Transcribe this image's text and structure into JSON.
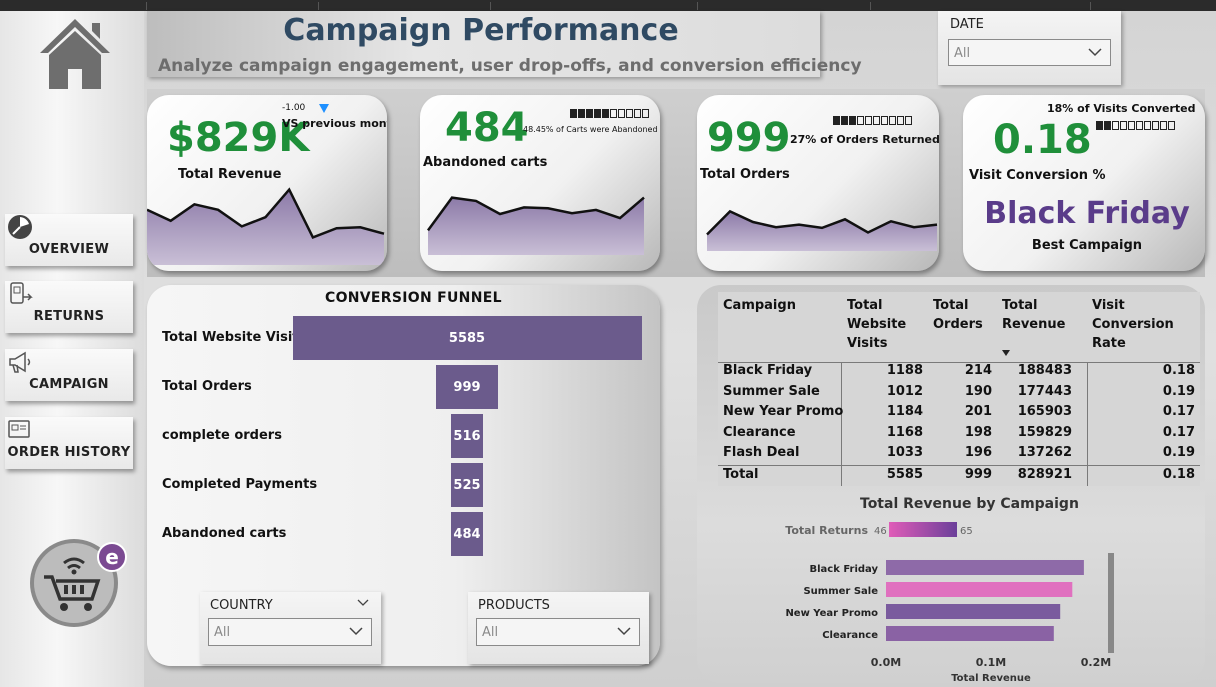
{
  "sidebar": {
    "nav": [
      {
        "label": "OVERVIEW",
        "icon": "overview-icon"
      },
      {
        "label": "RETURNS",
        "icon": "returns-icon"
      },
      {
        "label": "CAMPAIGN",
        "icon": "megaphone-icon"
      },
      {
        "label": "ORDER HISTORY",
        "icon": "order-history-icon"
      }
    ],
    "logo_icon": "ecommerce-cart-logo",
    "home_icon": "home-icon"
  },
  "header": {
    "title": "Campaign Performance",
    "subtitle": "Analyze campaign engagement, user drop-offs, and conversion efficiency"
  },
  "date_filter": {
    "label": "DATE",
    "value": "All"
  },
  "kpis": {
    "revenue": {
      "value": "$829K",
      "label": "Total Revenue",
      "delta": "-1.00",
      "delta_label": "VS previous month",
      "delta_color": "#1e90ff"
    },
    "abandoned": {
      "value": "484",
      "label": "Abandoned carts",
      "note": "48.45% of Carts were Abandoned",
      "filled_blocks": 5,
      "total_blocks": 10
    },
    "orders": {
      "value": "999",
      "label": "Total Orders",
      "note": "27% of Orders Returned",
      "filled_blocks": 3,
      "total_blocks": 10
    },
    "conversion": {
      "value": "0.18",
      "label": "Visit Conversion %",
      "note": "18% of Visits Converted",
      "filled_blocks": 2,
      "total_blocks": 10,
      "best_campaign": "Black Friday",
      "best_label": "Best Campaign"
    }
  },
  "colors": {
    "kpi_green": "#1f8f3a",
    "purple": "#6b5b8c",
    "best_purple": "#5a3c8a",
    "title_blue": "#2f4a63",
    "pink": "#e05cb8"
  },
  "funnel": {
    "title": "CONVERSION FUNNEL",
    "stages": [
      {
        "label": "Total Website Visits",
        "value": 5585
      },
      {
        "label": "Total Orders",
        "value": 999
      },
      {
        "label": "complete orders",
        "value": 516
      },
      {
        "label": "Completed Payments",
        "value": 525
      },
      {
        "label": "Abandoned carts",
        "value": 484
      }
    ]
  },
  "slicers": {
    "country": {
      "label": "COUNTRY",
      "value": "All"
    },
    "products": {
      "label": "PRODUCTS",
      "value": "All"
    }
  },
  "campaign_table": {
    "columns": [
      "Campaign",
      "Total Website Visits",
      "Total Orders",
      "Total Revenue",
      "Visit Conversion Rate"
    ],
    "rows": [
      [
        "Black Friday",
        "1188",
        "214",
        "188483",
        "0.18"
      ],
      [
        "Summer Sale",
        "1012",
        "190",
        "177443",
        "0.19"
      ],
      [
        "New Year Promo",
        "1184",
        "201",
        "165903",
        "0.17"
      ],
      [
        "Clearance",
        "1168",
        "198",
        "159829",
        "0.17"
      ],
      [
        "Flash Deal",
        "1033",
        "196",
        "137262",
        "0.19"
      ]
    ],
    "total": [
      "Total",
      "5585",
      "999",
      "828921",
      "0.18"
    ]
  },
  "chart_data": [
    {
      "type": "bar",
      "title": "Total Revenue by Campaign",
      "orientation": "horizontal",
      "categories": [
        "Black Friday",
        "Summer Sale",
        "New Year Promo",
        "Clearance"
      ],
      "values": [
        188483,
        177443,
        165903,
        159829
      ],
      "xlabel": "Total Revenue",
      "x_ticks": [
        "0.0M",
        "0.1M",
        "0.2M"
      ],
      "xlim": [
        0,
        200000
      ],
      "legend": {
        "label": "Total Returns",
        "min": "46",
        "max": "65"
      },
      "grid": false
    },
    {
      "type": "area",
      "title": "",
      "values": [
        60,
        48,
        66,
        60,
        42,
        52,
        82,
        30,
        40,
        41,
        34
      ]
    },
    {
      "type": "area",
      "title": "",
      "values": [
        30,
        70,
        66,
        50,
        58,
        57,
        51,
        55,
        45,
        70
      ]
    },
    {
      "type": "area",
      "title": "",
      "values": [
        25,
        60,
        44,
        36,
        40,
        35,
        48,
        28,
        45,
        36,
        40
      ]
    }
  ]
}
